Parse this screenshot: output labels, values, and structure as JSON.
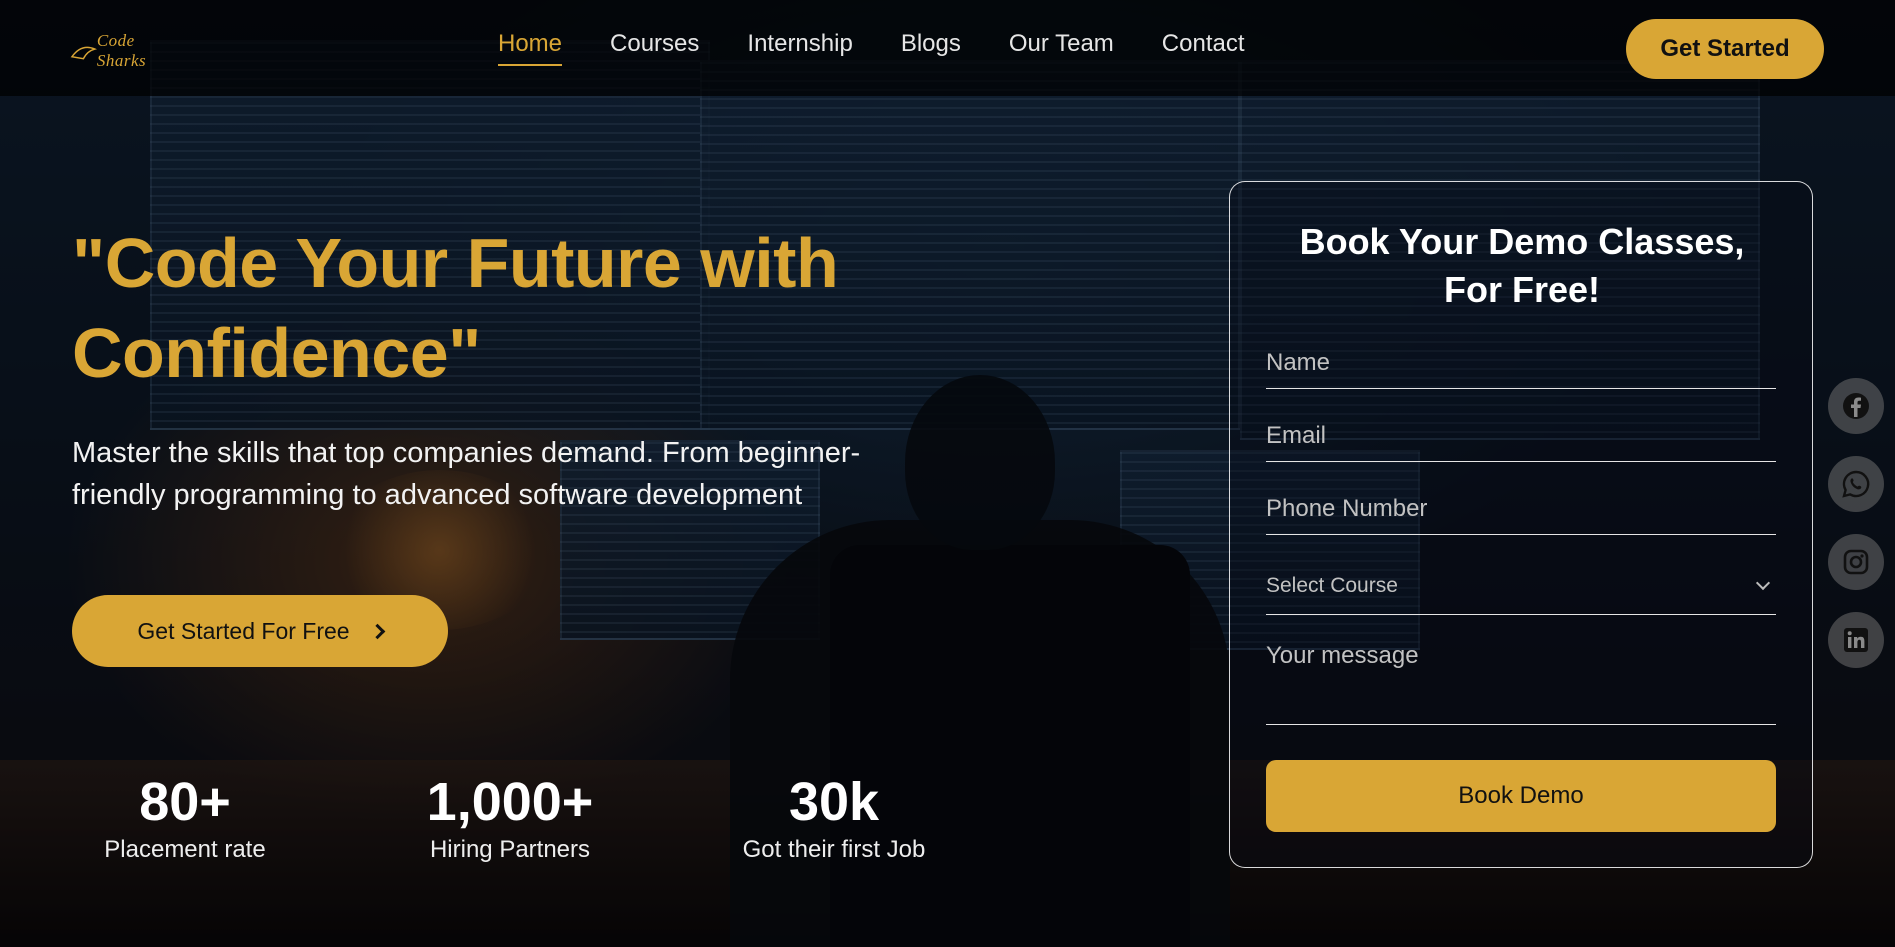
{
  "brand": {
    "logo_text": "Code Sharks"
  },
  "nav": {
    "links": [
      "Home",
      "Courses",
      "Internship",
      "Blogs",
      "Our Team",
      "Contact"
    ],
    "active": "Home",
    "cta_label": "Get Started"
  },
  "hero": {
    "title": "\"Code Your Future with Confidence\"",
    "subtitle": "Master the skills that top companies demand. From beginner-friendly programming to advanced software development",
    "cta_label": "Get Started For Free"
  },
  "stats": [
    {
      "value": "80+",
      "label": "Placement rate"
    },
    {
      "value": "1,000+",
      "label": "Hiring Partners"
    },
    {
      "value": "30k",
      "label": "Got their first Job"
    }
  ],
  "form": {
    "title": "Book Your Demo Classes, For Free!",
    "name_placeholder": "Name",
    "email_placeholder": "Email",
    "phone_placeholder": "Phone Number",
    "course_select_value": "Select Course",
    "message_placeholder": "Your message",
    "submit_label": "Book Demo"
  },
  "social": [
    "facebook-icon",
    "whatsapp-icon",
    "instagram-icon",
    "linkedin-icon"
  ],
  "colors": {
    "accent": "#d9a635",
    "text": "#ffffff",
    "nav_bg": "#000000"
  }
}
